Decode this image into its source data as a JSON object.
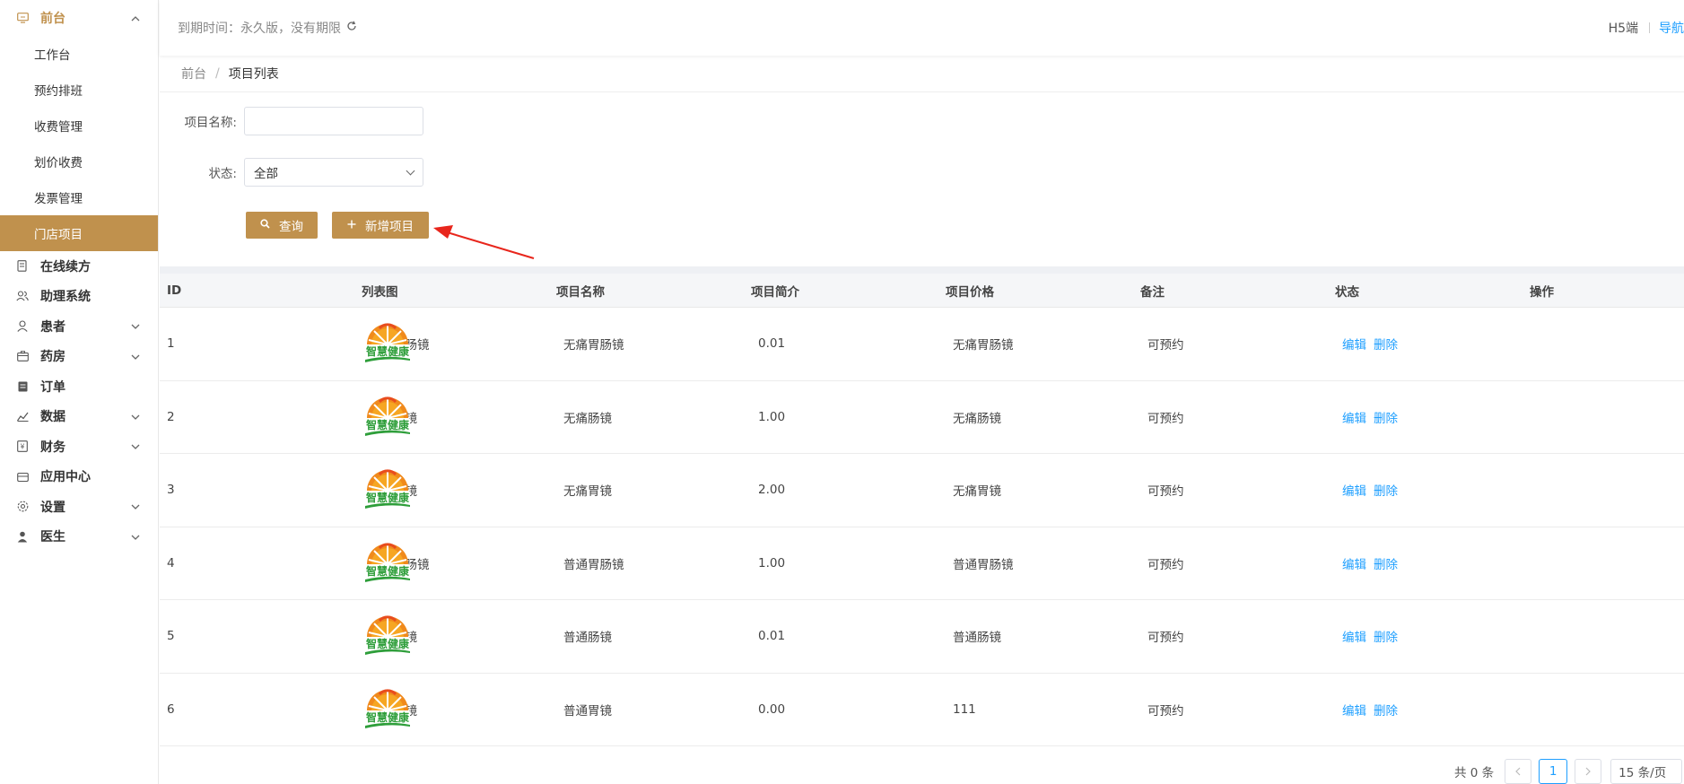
{
  "sidebar": {
    "group_frontdesk": {
      "label": "前台",
      "icon": "monitor-icon"
    },
    "sub_items": [
      {
        "label": "工作台",
        "name": "sidebar-item-workbench"
      },
      {
        "label": "预约排班",
        "name": "sidebar-item-appointment-schedule"
      },
      {
        "label": "收费管理",
        "name": "sidebar-item-charge-management"
      },
      {
        "label": "划价收费",
        "name": "sidebar-item-pricing-charge"
      },
      {
        "label": "发票管理",
        "name": "sidebar-item-invoice-management"
      },
      {
        "label": "门店项目",
        "name": "sidebar-item-store-projects",
        "active": true
      }
    ],
    "groups": [
      {
        "label": "在线续方",
        "icon": "document-icon",
        "chevron": false
      },
      {
        "label": "助理系统",
        "icon": "users-icon",
        "chevron": false
      },
      {
        "label": "患者",
        "icon": "user-icon",
        "chevron": true
      },
      {
        "label": "药房",
        "icon": "pharmacy-icon",
        "chevron": true
      },
      {
        "label": "订单",
        "icon": "order-icon",
        "chevron": false
      },
      {
        "label": "数据",
        "icon": "chart-icon",
        "chevron": true
      },
      {
        "label": "财务",
        "icon": "finance-icon",
        "chevron": true
      },
      {
        "label": "应用中心",
        "icon": "app-icon",
        "chevron": false
      },
      {
        "label": "设置",
        "icon": "gear-icon",
        "chevron": true
      },
      {
        "label": "医生",
        "icon": "doctor-icon",
        "chevron": true
      }
    ]
  },
  "topbar": {
    "expire_text": "到期时间：永久版，没有期限",
    "h5_label": "H5端",
    "nav_label": "导航"
  },
  "breadcrumb": {
    "parent": "前台",
    "current": "项目列表"
  },
  "filters": {
    "name_label": "项目名称:",
    "name_value": "",
    "status_label": "状态:",
    "status_value": "全部"
  },
  "buttons": {
    "query": "查询",
    "add": "新增项目"
  },
  "colors": {
    "accent": "#c0914d",
    "link": "#1e9fff",
    "annotation_arrow": "#e8261c"
  },
  "table": {
    "headers": [
      "ID",
      "列表图",
      "项目名称",
      "项目简介",
      "项目价格",
      "备注",
      "状态",
      "操作"
    ],
    "rows": [
      {
        "id": "1",
        "name": "无痛胃肠镜",
        "intro": "无痛胃肠镜",
        "price": "0.01",
        "note": "无痛胃肠镜",
        "status": "可预约"
      },
      {
        "id": "2",
        "name": "无痛肠镜",
        "intro": "无痛肠镜",
        "price": "1.00",
        "note": "无痛肠镜",
        "status": "可预约"
      },
      {
        "id": "3",
        "name": "无痛胃镜",
        "intro": "无痛胃镜",
        "price": "2.00",
        "note": "无痛胃镜",
        "status": "可预约"
      },
      {
        "id": "4",
        "name": "普通胃肠镜",
        "intro": "普通胃肠镜",
        "price": "1.00",
        "note": "普通胃肠镜",
        "status": "可预约"
      },
      {
        "id": "5",
        "name": "普通肠镜",
        "intro": "普通肠镜",
        "price": "0.01",
        "note": "普通肠镜",
        "status": "可预约"
      },
      {
        "id": "6",
        "name": "普通胃镜",
        "intro": "普通胃镜",
        "price": "0.00",
        "note": "111",
        "status": "可预约"
      }
    ],
    "action_edit": "编辑",
    "action_delete": "删除",
    "logo_text": "智慧健康"
  },
  "pagination": {
    "total_text": "共 0 条",
    "current_page": "1",
    "page_size": "15 条/页"
  }
}
